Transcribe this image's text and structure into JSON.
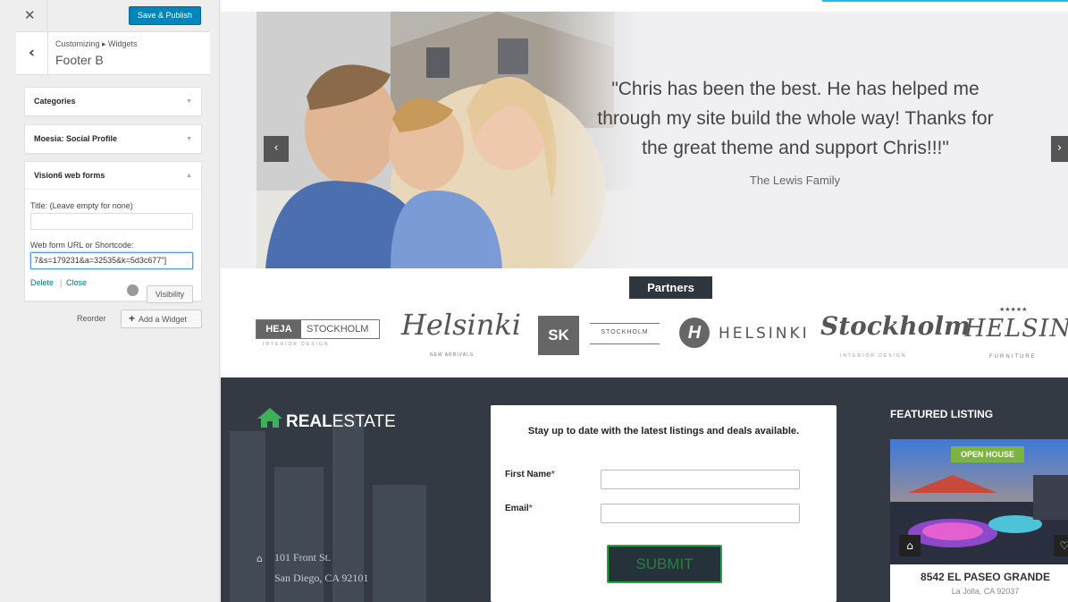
{
  "customizer": {
    "close_icon": "close-icon",
    "publish_label": "Save & Publish",
    "breadcrumb": "Customizing ▸ Widgets",
    "section_title": "Footer B",
    "widgets": [
      {
        "title": "Categories",
        "arrow": "▼"
      },
      {
        "title": "Moesia: Social Profile",
        "arrow": "▼"
      },
      {
        "title": "Vision6 web forms",
        "arrow": "▲"
      }
    ],
    "form": {
      "title_label": "Title: (Leave empty for none)",
      "title_value": "",
      "url_label": "Web form URL or Shortcode:",
      "url_value": "7&s=179231&a=32535&k=5d3c677\"]",
      "delete_label": "Delete",
      "separator": "|",
      "close_label": "Close",
      "visibility_label": "Visibility"
    },
    "reorder_label": "Reorder",
    "add_widget_label": "Add a Widget",
    "add_widget_plus": "+",
    "accent_color": "#0085ba"
  },
  "preview": {
    "testimonial": {
      "quote_lines": [
        "\"Chris has been the best. He has helped me",
        "through my site build the whole way! Thanks for",
        "the great theme and support Chris!!!\""
      ],
      "author": "The Lewis Family",
      "prev_icon": "‹",
      "next_icon": "›"
    },
    "partners": {
      "heading": "Partners",
      "logos": [
        {
          "main_left": "HEJA",
          "main_right": "STOCKHOLM",
          "sub": "INTERIOR DESIGN"
        },
        {
          "main": "Helsinki",
          "sub": "NEW ARRIVALS"
        },
        {
          "mark": "SK",
          "word": "STOCKHOLM"
        },
        {
          "mark": "H",
          "word": "HELSINKI"
        },
        {
          "main": "Stockholm",
          "sub": "INTERIOR DESIGN"
        },
        {
          "stars": "★★★★★",
          "main": "HELSINKI",
          "sub": "FURNITURE"
        }
      ]
    },
    "footer": {
      "brand_bold": "REAL",
      "brand_light": "ESTATE",
      "address_line1": "101 Front St.",
      "address_line2": "San Diego, CA 92101",
      "form_intro": "Stay up to date with the latest listings and deals available.",
      "first_name_label": "First Name",
      "email_label": "Email",
      "required_mark": "*",
      "submit_label": "SUBMIT",
      "featured_title": "FEATURED LISTING",
      "listing_badge": "OPEN HOUSE",
      "listing_name": "8542 EL PASEO GRANDE",
      "listing_city": "La Jolla, CA 92037",
      "brand_color": "#3cb15a"
    }
  }
}
